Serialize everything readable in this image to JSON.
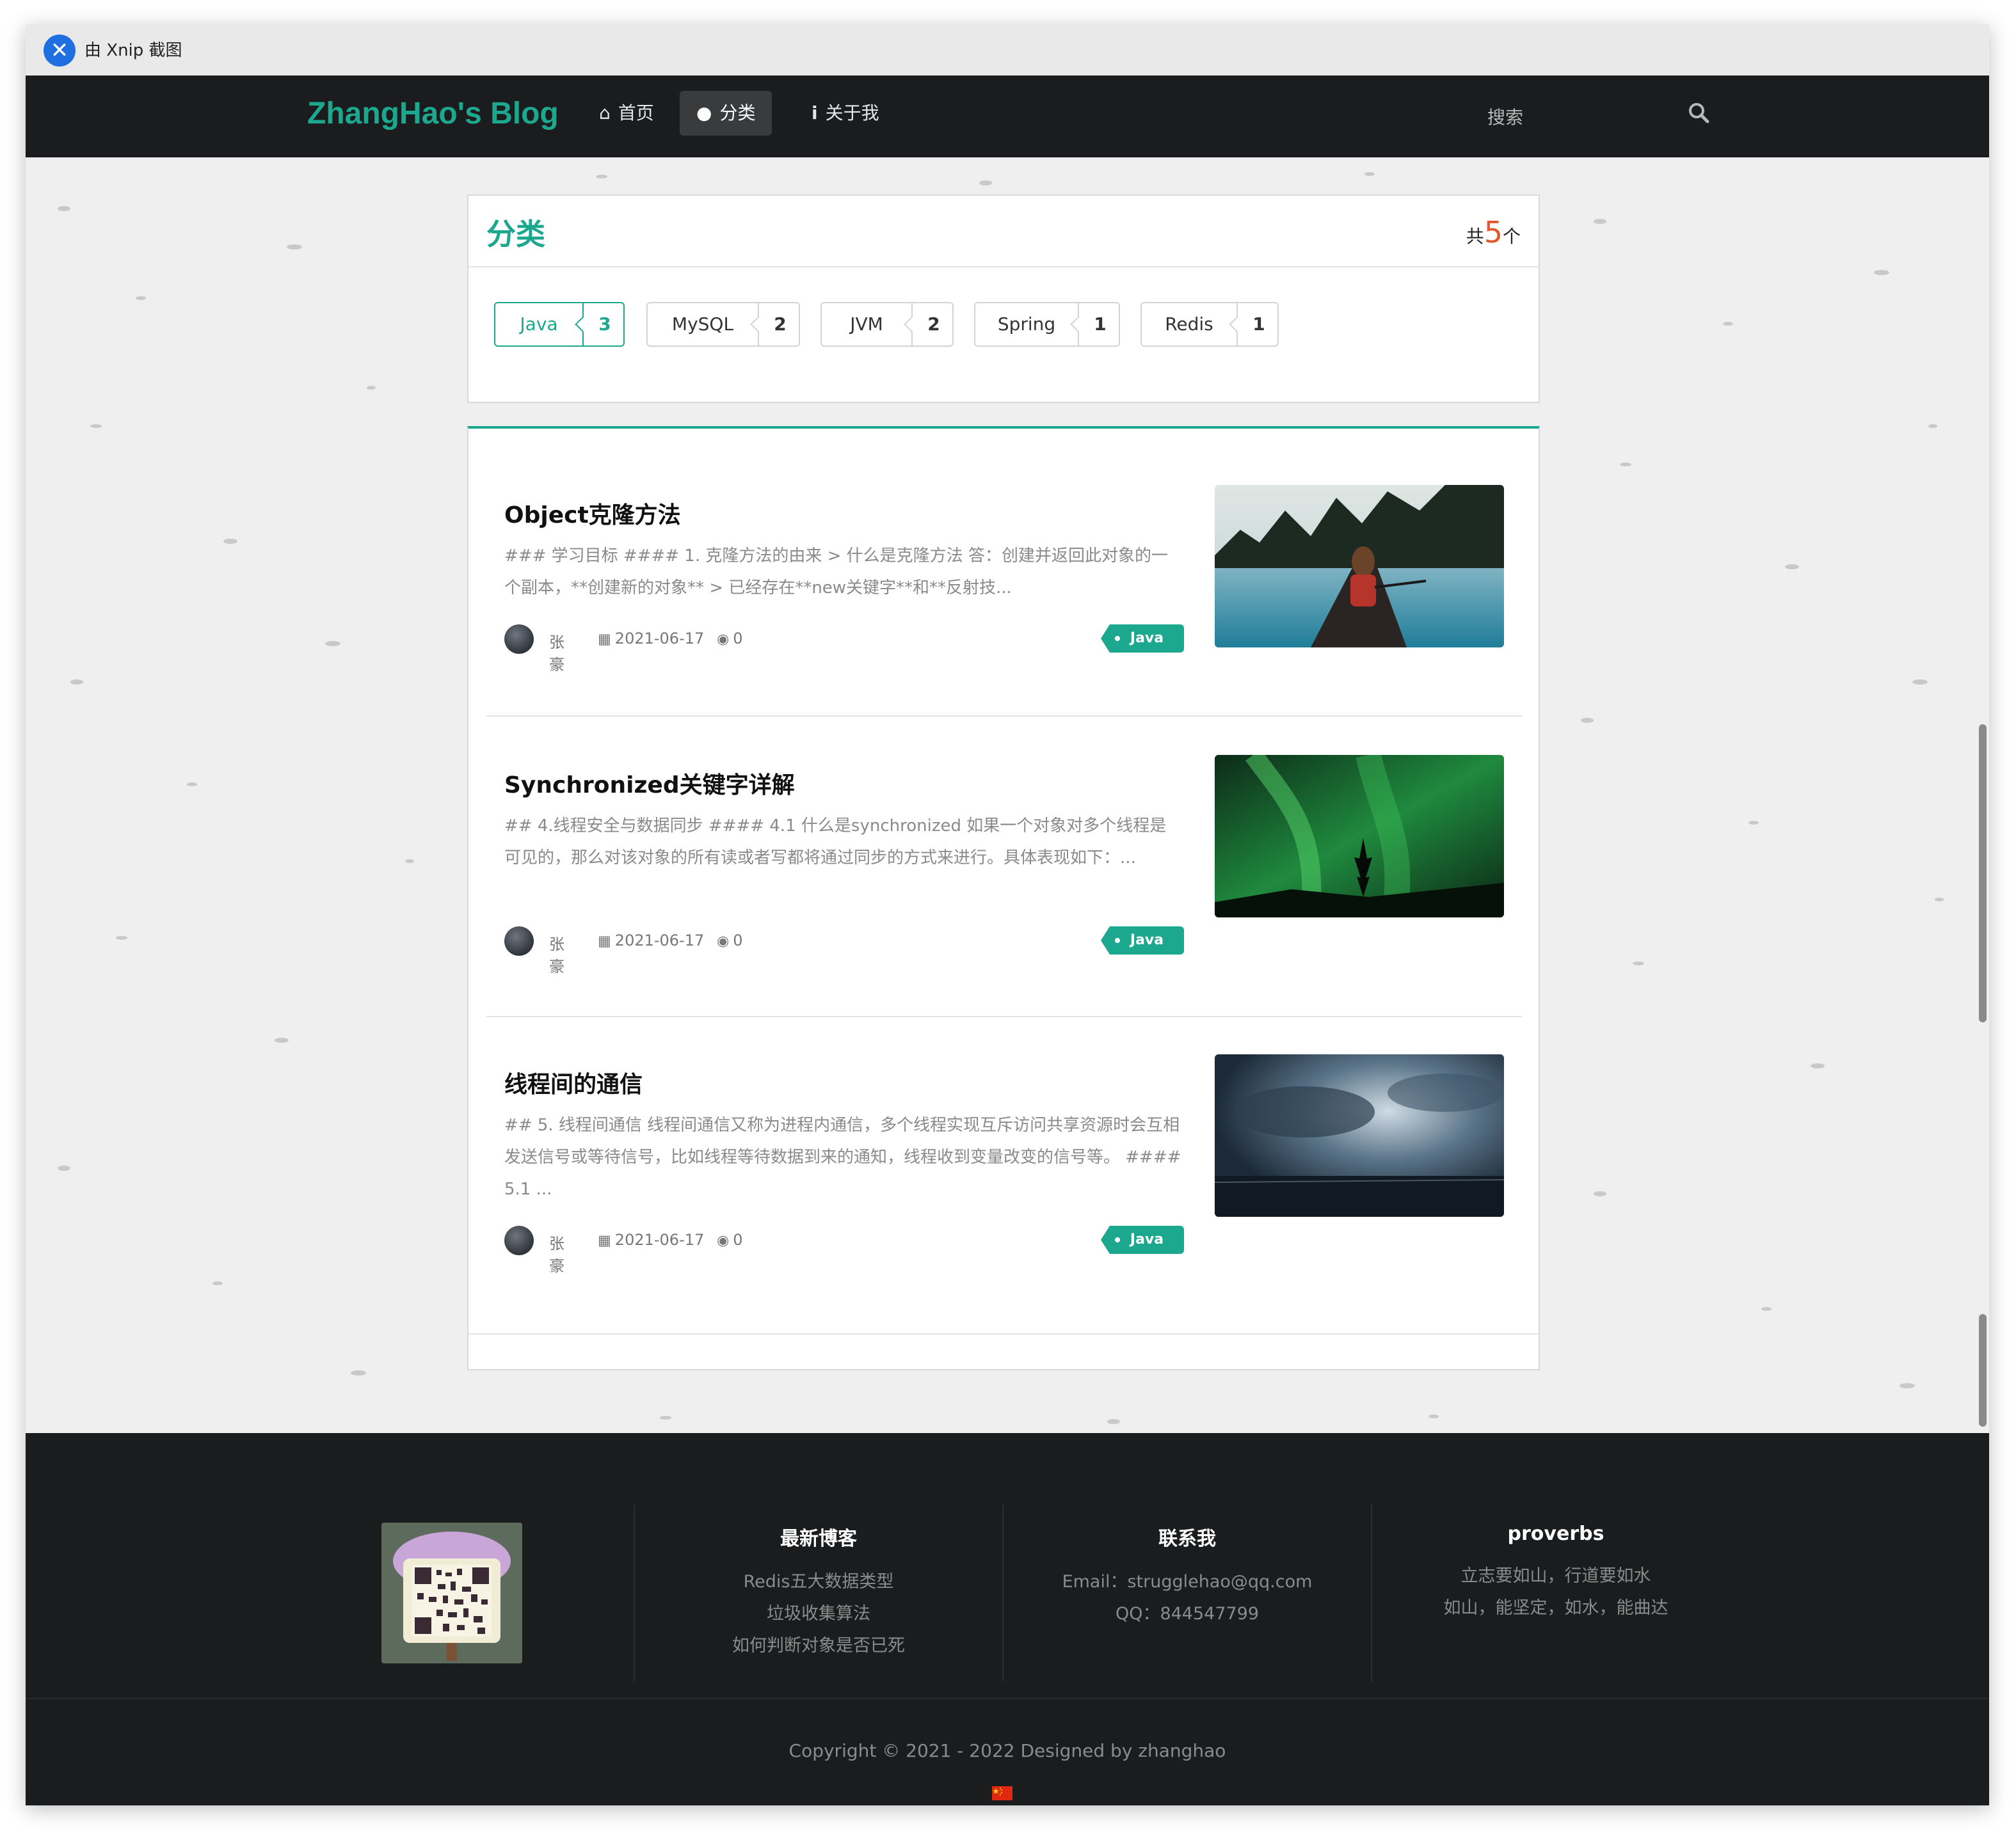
{
  "titlebar": {
    "text": "由 Xnip 截图",
    "logo_icon": "xnip-icon"
  },
  "navbar": {
    "brand": "ZhangHao's Blog",
    "items": [
      {
        "label": "首页",
        "icon": "home-icon"
      },
      {
        "label": "分类",
        "icon": "lightbulb-icon",
        "active": true
      },
      {
        "label": "关于我",
        "icon": "info-icon"
      }
    ],
    "search_placeholder": "搜索"
  },
  "categories": {
    "title": "分类",
    "count_prefix": "共",
    "count": "5",
    "count_suffix": "个",
    "labels": [
      {
        "name": "Java",
        "count": "3",
        "active": true
      },
      {
        "name": "MySQL",
        "count": "2"
      },
      {
        "name": "JVM",
        "count": "2"
      },
      {
        "name": "Spring",
        "count": "1"
      },
      {
        "name": "Redis",
        "count": "1"
      }
    ]
  },
  "posts": [
    {
      "title": "Object克隆方法",
      "excerpt": "### 学习目标 #### 1. 克隆方法的由来 > 什么是克隆方法 答：创建并返回此对象的一个副本，**创建新的对象** > 已经存在**new关键字**和**反射技...",
      "author": "张豪",
      "date": "2021-06-17",
      "views": "0",
      "tag": "Java"
    },
    {
      "title": "Synchronized关键字详解",
      "excerpt": "## 4.线程安全与数据同步 #### 4.1 什么是synchronized 如果一个对象对多个线程是可见的，那么对该对象的所有读或者写都将通过同步的方式来进行。具体表现如下：...",
      "author": "张豪",
      "date": "2021-06-17",
      "views": "0",
      "tag": "Java"
    },
    {
      "title": "线程间的通信",
      "excerpt": "## 5. 线程间通信 线程间通信又称为进程内通信，多个线程实现互斥访问共享资源时会互相发送信号或等待信号，比如线程等待数据到来的通知，线程收到变量改变的信号等。 #### 5.1 ...",
      "author": "张豪",
      "date": "2021-06-17",
      "views": "0",
      "tag": "Java"
    }
  ],
  "footer": {
    "col1": {
      "title": "最新博客",
      "links": [
        "Redis五大数据类型",
        "垃圾收集算法",
        "如何判断对象是否已死"
      ]
    },
    "col2": {
      "title": "联系我",
      "lines": [
        "Email：strugglehao@qq.com",
        "QQ：844547799"
      ]
    },
    "col3": {
      "title": "proverbs",
      "lines": [
        "立志要如山，行道要如水",
        "如山，能坚定，如水，能曲达"
      ]
    },
    "copyright": "Copyright © 2021 - 2022 Designed by zhanghao"
  },
  "colors": {
    "accent": "#1ca78f",
    "navbar_bg": "#1b1c1d",
    "count_orange": "#e2582d"
  }
}
